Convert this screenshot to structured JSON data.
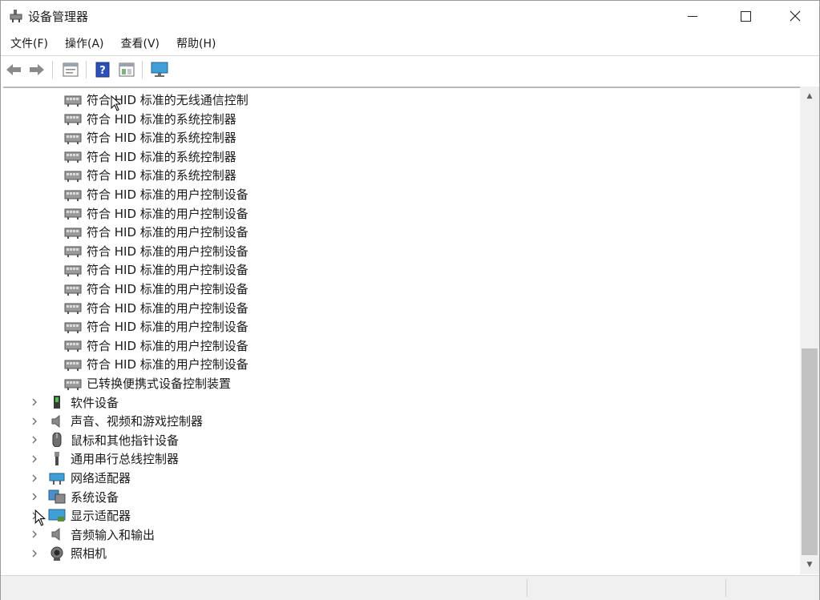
{
  "window": {
    "title": "设备管理器"
  },
  "menu": [
    {
      "label": "文件(F)"
    },
    {
      "label": "操作(A)"
    },
    {
      "label": "查看(V)"
    },
    {
      "label": "帮助(H)"
    }
  ],
  "toolbar": {
    "icons": [
      "back-arrow-icon",
      "forward-arrow-icon",
      "properties-icon",
      "help-icon",
      "device-view-icon",
      "monitor-scan-icon"
    ]
  },
  "tree": {
    "children": [
      {
        "label": "符合 HID 标准的无线通信控制"
      },
      {
        "label": "符合 HID 标准的系统控制器"
      },
      {
        "label": "符合 HID 标准的系统控制器"
      },
      {
        "label": "符合 HID 标准的系统控制器"
      },
      {
        "label": "符合 HID 标准的系统控制器"
      },
      {
        "label": "符合 HID 标准的用户控制设备"
      },
      {
        "label": "符合 HID 标准的用户控制设备"
      },
      {
        "label": "符合 HID 标准的用户控制设备"
      },
      {
        "label": "符合 HID 标准的用户控制设备"
      },
      {
        "label": "符合 HID 标准的用户控制设备"
      },
      {
        "label": "符合 HID 标准的用户控制设备"
      },
      {
        "label": "符合 HID 标准的用户控制设备"
      },
      {
        "label": "符合 HID 标准的用户控制设备"
      },
      {
        "label": "符合 HID 标准的用户控制设备"
      },
      {
        "label": "符合 HID 标准的用户控制设备"
      },
      {
        "label": "已转换便携式设备控制装置"
      }
    ],
    "categories": [
      {
        "label": "软件设备",
        "icon": "software-device-icon"
      },
      {
        "label": "声音、视频和游戏控制器",
        "icon": "speaker-icon"
      },
      {
        "label": "鼠标和其他指针设备",
        "icon": "mouse-icon"
      },
      {
        "label": "通用串行总线控制器",
        "icon": "usb-icon"
      },
      {
        "label": "网络适配器",
        "icon": "network-adapter-icon"
      },
      {
        "label": "系统设备",
        "icon": "system-device-icon"
      },
      {
        "label": "显示适配器",
        "icon": "display-adapter-icon"
      },
      {
        "label": "音频输入和输出",
        "icon": "audio-io-icon"
      },
      {
        "label": "照相机",
        "icon": "camera-icon"
      }
    ]
  }
}
